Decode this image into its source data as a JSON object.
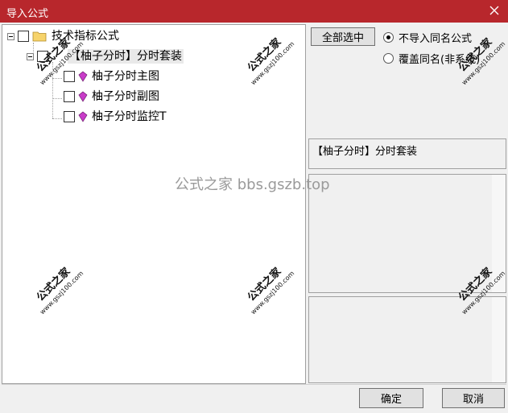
{
  "window": {
    "title": "导入公式",
    "title_bg": "#b8272c"
  },
  "tree": {
    "root": {
      "label": "技术指标公式",
      "icon": "folder-icon"
    },
    "group": {
      "label": "【柚子分时】分时套装"
    },
    "items": [
      {
        "label": "柚子分时主图",
        "icon": "gem-icon"
      },
      {
        "label": "柚子分时副图",
        "icon": "gem-icon"
      },
      {
        "label": "柚子分时监控T",
        "icon": "gem-icon"
      }
    ]
  },
  "options": {
    "select_all_label": "全部选中",
    "radio_no_import": "不导入同名公式",
    "radio_overwrite": "覆盖同名(非系统)",
    "selected": "no_import"
  },
  "detail": {
    "name": "【柚子分时】分时套装"
  },
  "watermark": {
    "center_text": "公式之家 bbs.gszb.top",
    "stamp_text": "公式之家",
    "stamp_url": "www.gszj100.com"
  },
  "buttons": {
    "ok": "确定",
    "cancel": "取消"
  }
}
